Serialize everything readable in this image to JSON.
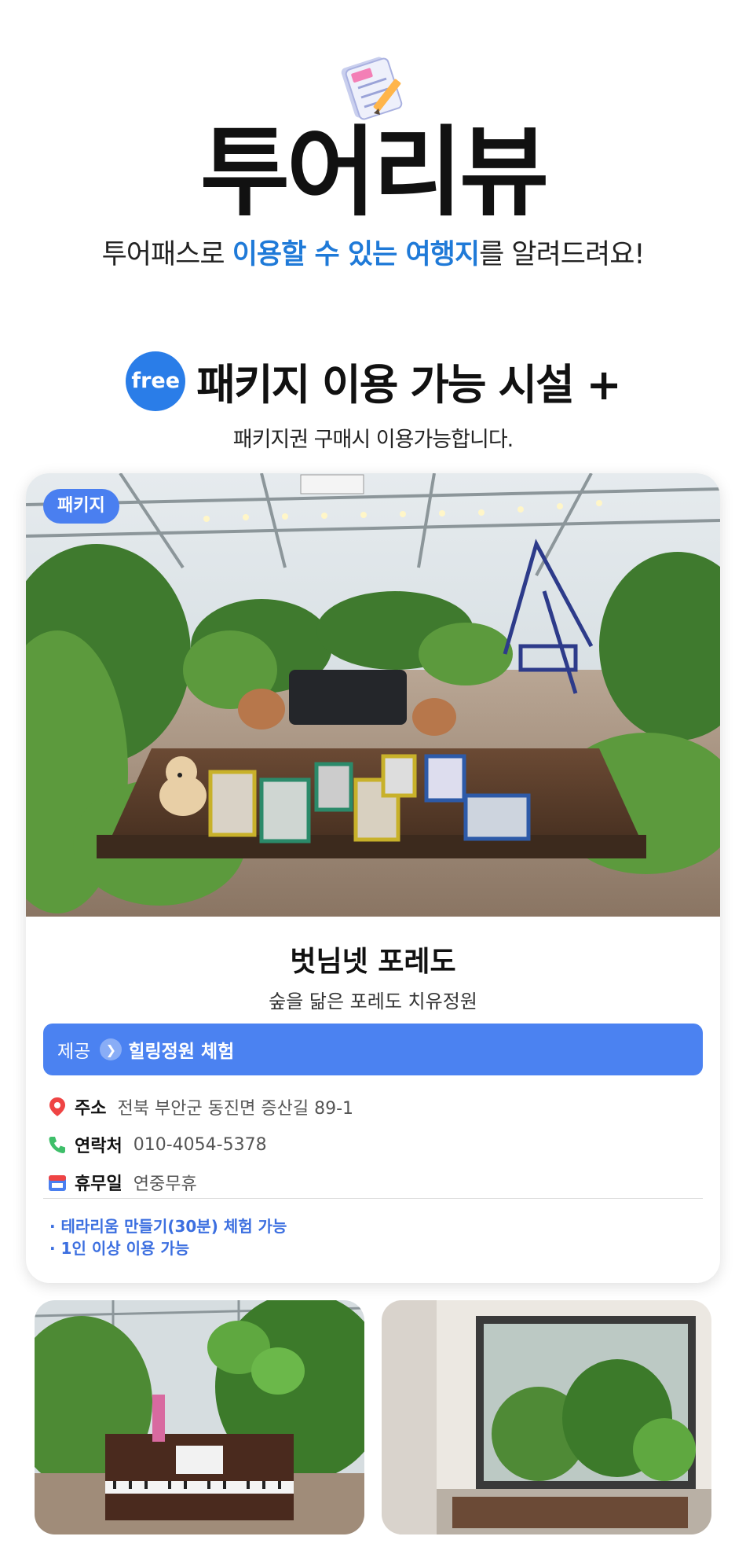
{
  "header": {
    "title": "투어리뷰",
    "subtitle_pre": "투어패스로 ",
    "subtitle_highlight": "이용할 수 있는 여행지",
    "subtitle_post": "를 알려드려요!"
  },
  "section": {
    "badge": "free",
    "title": "패키지 이용 가능 시설 +",
    "description": "패키지권 구매시 이용가능합니다."
  },
  "card": {
    "badge": "패키지",
    "name": "벗님넷 포레도",
    "tagline": "숲을 닮은 포레도 치유정원",
    "offer_label": "제공",
    "offer_value": "힐링정원 체험",
    "address_label": "주소",
    "address_value": "전북 부안군 동진면 증산길 89-1",
    "phone_label": "연락처",
    "phone_value": "010-4054-5378",
    "holiday_label": "휴무일",
    "holiday_value": "연중무휴",
    "notes": [
      "· 테라리움 만들기(30분) 체험 가능",
      "· 1인 이상 이용 가능"
    ]
  },
  "colors": {
    "accent": "#1f7ad8",
    "offer_bar": "#4b82f1",
    "badge": "#2a7de8"
  }
}
